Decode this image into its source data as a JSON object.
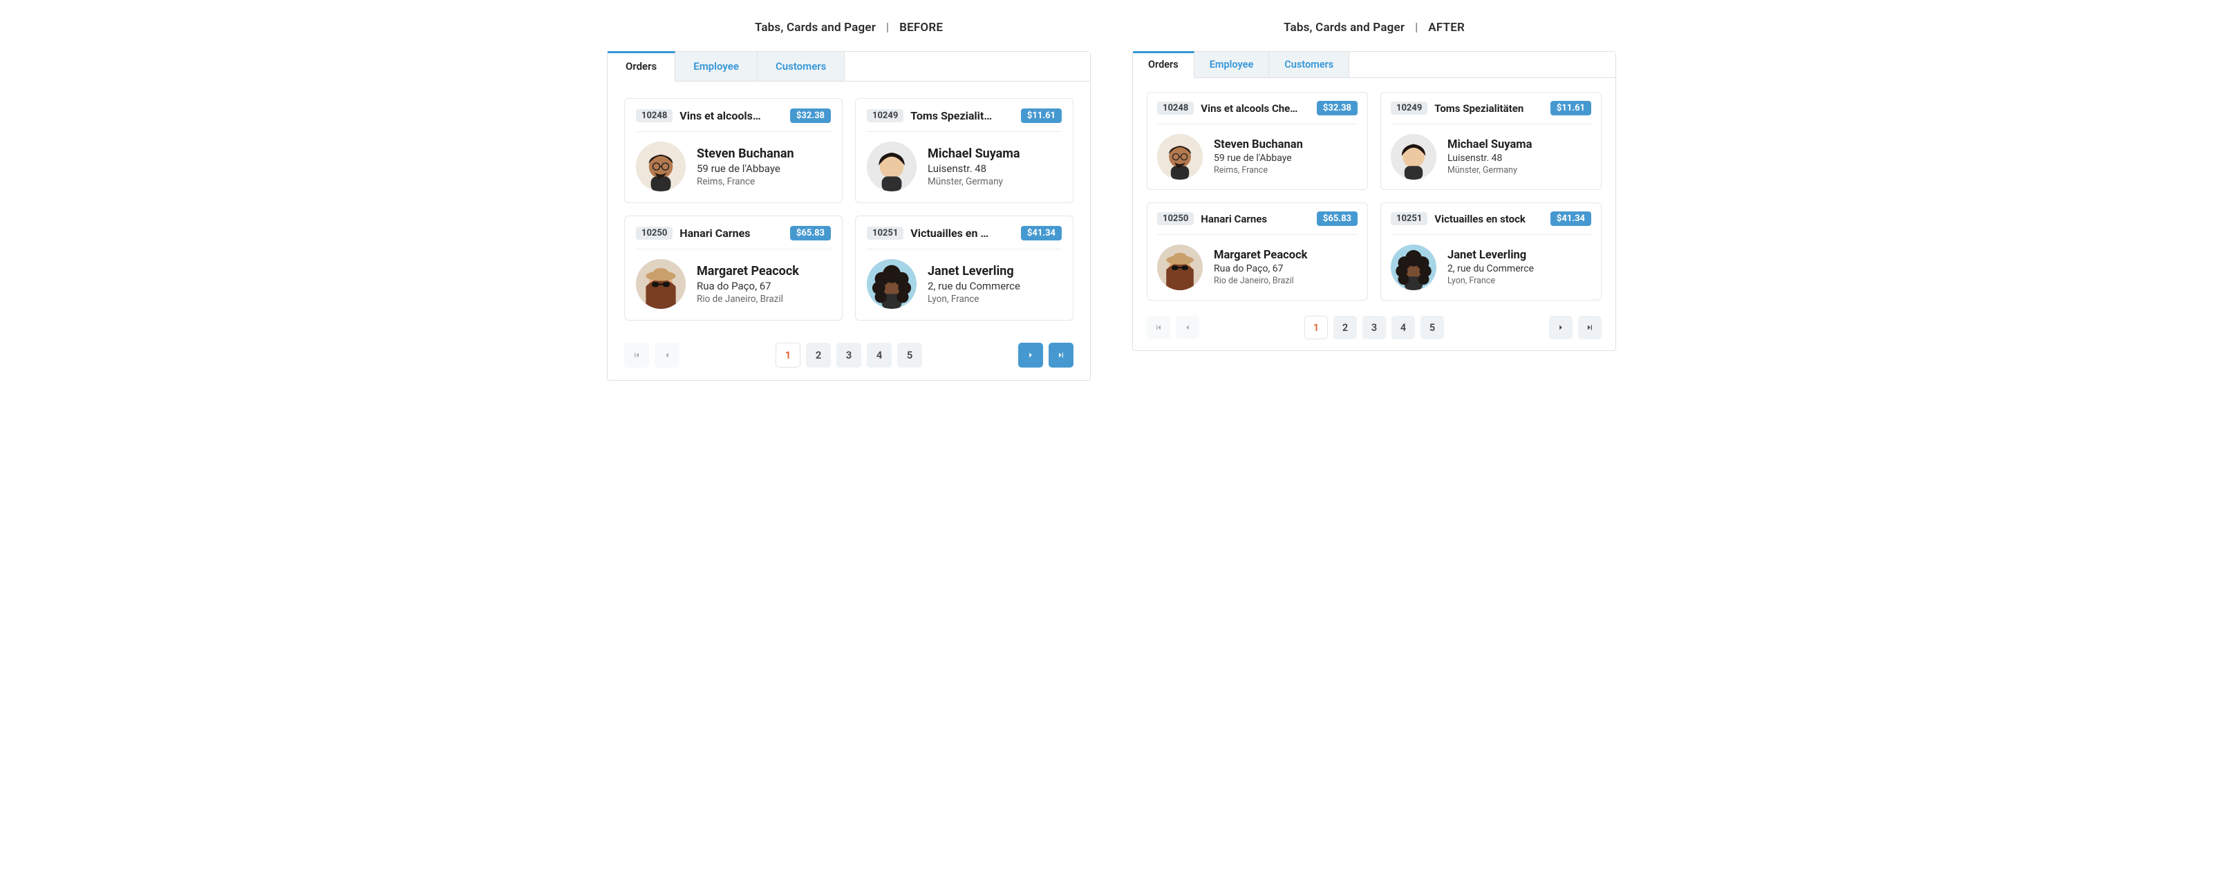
{
  "titles": {
    "base": "Tabs, Cards and Pager",
    "sep": "|",
    "before": "BEFORE",
    "after": "AFTER"
  },
  "tabs": [
    {
      "id": "orders",
      "label": "Orders",
      "active": true
    },
    {
      "id": "employee",
      "label": "Employee",
      "active": false
    },
    {
      "id": "customers",
      "label": "Customers",
      "active": false
    }
  ],
  "orders_before": [
    {
      "order_id": "10248",
      "customer": "Vins et alcools…",
      "price": "$32.38",
      "employee": "Steven Buchanan",
      "address": "59 rue de l'Abbaye",
      "city": "Reims, France",
      "avatar": "steven"
    },
    {
      "order_id": "10249",
      "customer": "Toms Spezialit…",
      "price": "$11.61",
      "employee": "Michael Suyama",
      "address": "Luisenstr. 48",
      "city": "Münster, Germany",
      "avatar": "michael"
    },
    {
      "order_id": "10250",
      "customer": "Hanari Carnes",
      "price": "$65.83",
      "employee": "Margaret Peacock",
      "address": "Rua do Paço, 67",
      "city": "Rio de Janeiro, Brazil",
      "avatar": "margaret"
    },
    {
      "order_id": "10251",
      "customer": "Victuailles en …",
      "price": "$41.34",
      "employee": "Janet Leverling",
      "address": "2, rue du Commerce",
      "city": "Lyon, France",
      "avatar": "janet"
    }
  ],
  "orders_after": [
    {
      "order_id": "10248",
      "customer": "Vins et alcools Che…",
      "price": "$32.38",
      "employee": "Steven Buchanan",
      "address": "59 rue de l'Abbaye",
      "city": "Reims, France",
      "avatar": "steven"
    },
    {
      "order_id": "10249",
      "customer": "Toms Spezialitäten",
      "price": "$11.61",
      "employee": "Michael Suyama",
      "address": "Luisenstr. 48",
      "city": "Münster, Germany",
      "avatar": "michael"
    },
    {
      "order_id": "10250",
      "customer": "Hanari Carnes",
      "price": "$65.83",
      "employee": "Margaret Peacock",
      "address": "Rua do Paço, 67",
      "city": "Rio de Janeiro, Brazil",
      "avatar": "margaret"
    },
    {
      "order_id": "10251",
      "customer": "Victuailles en stock",
      "price": "$41.34",
      "employee": "Janet Leverling",
      "address": "2, rue du Commerce",
      "city": "Lyon, France",
      "avatar": "janet"
    }
  ],
  "pager": {
    "pages": [
      "1",
      "2",
      "3",
      "4",
      "5"
    ],
    "active": "1"
  },
  "avatar_colors": {
    "steven": {
      "bg": "#efe7dc",
      "skin": "#b47a4e",
      "hair": "#241a14",
      "extra": "#2b2b2b"
    },
    "michael": {
      "bg": "#e9e9e9",
      "skin": "#edc9a2",
      "hair": "#1c140f",
      "extra": "#2f2f2f"
    },
    "margaret": {
      "bg": "#e1d3c2",
      "skin": "#e7b38a",
      "hair": "#7a3e22",
      "extra": "#1b1b1b"
    },
    "janet": {
      "bg": "#a7d5e8",
      "skin": "#7a4e32",
      "hair": "#1e1714",
      "extra": "#2e2e2e"
    }
  }
}
